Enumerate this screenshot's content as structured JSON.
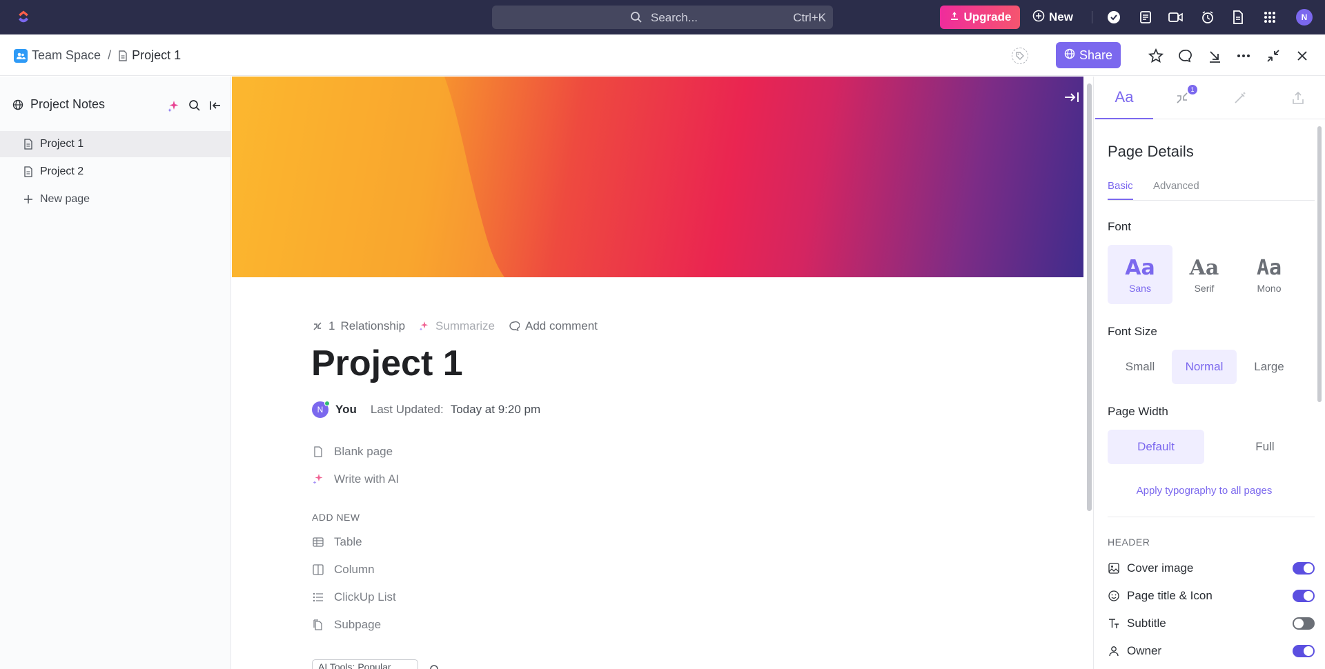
{
  "topbar": {
    "search_label": "Search...",
    "search_shortcut": "Ctrl+K",
    "upgrade_label": "Upgrade",
    "new_label": "New",
    "avatar_initial": "N"
  },
  "header": {
    "space_name": "Team Space",
    "page_name": "Project 1",
    "share_label": "Share"
  },
  "sidebar": {
    "title": "Project Notes",
    "items": [
      {
        "label": "Project 1"
      },
      {
        "label": "Project 2"
      }
    ],
    "new_page_label": "New page"
  },
  "page": {
    "relationship_count": "1",
    "relationship_label": "Relationship",
    "summarize_label": "Summarize",
    "add_comment_label": "Add comment",
    "title": "Project 1",
    "owner_initial": "N",
    "owner_name": "You",
    "last_updated_label": "Last Updated:",
    "last_updated_value": "Today at 9:20 pm",
    "start_options": [
      {
        "label": "Blank page"
      },
      {
        "label": "Write with AI"
      }
    ],
    "add_new_heading": "ADD NEW",
    "add_new_items": [
      {
        "label": "Table"
      },
      {
        "label": "Column"
      },
      {
        "label": "ClickUp List"
      },
      {
        "label": "Subpage"
      }
    ],
    "ai_tools_label": "AI Tools: Popular"
  },
  "panel": {
    "relationship_badge": "1",
    "title": "Page Details",
    "subtabs": [
      "Basic",
      "Advanced"
    ],
    "font_heading": "Font",
    "fonts": [
      {
        "sample": "Aa",
        "name": "Sans"
      },
      {
        "sample": "Aa",
        "name": "Serif"
      },
      {
        "sample": "Aa",
        "name": "Mono"
      }
    ],
    "font_size_heading": "Font Size",
    "font_sizes": [
      "Small",
      "Normal",
      "Large"
    ],
    "page_width_heading": "Page Width",
    "page_widths": [
      "Default",
      "Full"
    ],
    "apply_link": "Apply typography to all pages",
    "header_section": "HEADER",
    "toggles": [
      {
        "label": "Cover image",
        "on": true
      },
      {
        "label": "Page title & Icon",
        "on": true
      },
      {
        "label": "Subtitle",
        "on": false
      },
      {
        "label": "Owner",
        "on": true
      }
    ],
    "first_tab_label": "Aa"
  },
  "colors": {
    "accent": "#7b68ee",
    "topbar": "#2b2d4a",
    "upgrade_start": "#ef2c9c",
    "upgrade_end": "#f5556f"
  }
}
